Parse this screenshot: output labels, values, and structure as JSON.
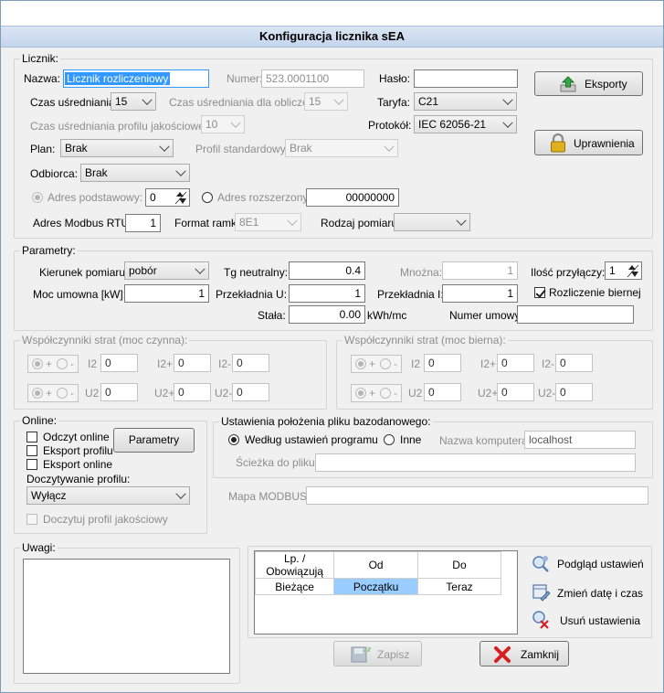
{
  "window": {
    "title": "Konfiguracja licznika sEA"
  },
  "licznik": {
    "group_title": "Licznik:",
    "nazwa_label": "Nazwa:",
    "nazwa_value": "Licznik rozliczeniowy",
    "numer_label": "Numer:",
    "numer_value": "523.0001100",
    "haslo_label": "Hasło:",
    "haslo_value": "",
    "czas_usr_label": "Czas uśredniania:",
    "czas_usr_value": "15",
    "czas_obl_label": "Czas uśredniania dla obliczeń:",
    "czas_obl_value": "15",
    "taryfa_label": "Taryfa:",
    "taryfa_value": "C21",
    "czas_prof_label": "Czas uśredniania profilu jakościowego:",
    "czas_prof_value": "10",
    "protokol_label": "Protokół:",
    "protokol_value": "IEC 62056-21",
    "plan_label": "Plan:",
    "plan_value": "Brak",
    "profil_label": "Profil standardowy:",
    "profil_value": "Brak",
    "odbiorca_label": "Odbiorca:",
    "odbiorca_value": "Brak",
    "adres_podst_label": "Adres podstawowy:",
    "adres_podst_value": "0",
    "adres_rozsz_label": "Adres rozszerzony:",
    "adres_rozsz_value": "00000000",
    "modbus_label": "Adres Modbus RTU:",
    "modbus_value": "1",
    "format_label": "Format ramki:",
    "format_value": "8E1",
    "rodzaj_label": "Rodzaj pomiaru:",
    "rodzaj_value": "",
    "eksporty_label": "Eksporty",
    "uprawnienia_label": "Uprawnienia"
  },
  "parametry": {
    "group_title": "Parametry:",
    "kierunek_label": "Kierunek pomiaru:",
    "kierunek_value": "pobór",
    "tg_label": "Tg neutralny:",
    "tg_value": "0.4",
    "mnozna_label": "Mnożna:",
    "mnozna_value": "1",
    "ilosc_label": "Ilość przyłączy:",
    "ilosc_value": "1",
    "moc_label": "Moc umowna [kW]:",
    "moc_value": "1",
    "przek_u_label": "Przekładnia U:",
    "przek_u_value": "1",
    "przek_i_label": "Przekładnia I:",
    "przek_i_value": "1",
    "rozliczenie_label": "Rozliczenie biernej",
    "stala_label": "Stała:",
    "stala_value": "0.00",
    "stala_unit": "kWh/mc",
    "numer_umowy_label": "Numer umowy:",
    "numer_umowy_value": ""
  },
  "wsp_czynna": {
    "group_title": "Współczynniki strat (moc czynna):",
    "plus": "+",
    "minus": "-",
    "i2": "I2",
    "i2p": "I2+",
    "i2m": "I2-",
    "u2": "U2",
    "u2p": "U2+",
    "u2m": "U2-",
    "i2_val": "0",
    "i2p_val": "0",
    "i2m_val": "0",
    "u2_val": "0",
    "u2p_val": "0",
    "u2m_val": "0"
  },
  "wsp_bierna": {
    "group_title": "Współczynniki strat (moc bierna):",
    "plus": "+",
    "minus": "-",
    "i2": "I2",
    "i2p": "I2+",
    "i2m": "I2-",
    "u2": "U2",
    "u2p": "U2+",
    "u2m": "U2-",
    "i2_val": "0",
    "i2p_val": "0",
    "i2m_val": "0",
    "u2_val": "0",
    "u2p_val": "0",
    "u2m_val": "0"
  },
  "online": {
    "group_title": "Online:",
    "odczyt_label": "Odczyt online",
    "eksport_profilu_label": "Eksport profilu",
    "eksport_online_label": "Eksport online",
    "parametry_button": "Parametry",
    "doczyt_label": "Doczytywanie profilu:",
    "doczyt_value": "Wyłącz",
    "doczyt_jak_label": "Doczytuj profil jakościowy"
  },
  "baza": {
    "group_title": "Ustawienia położenia pliku bazodanowego:",
    "wedlug_label": "Według ustawień programu",
    "inne_label": "Inne",
    "komputer_label": "Nazwa komputera:",
    "komputer_value": "localhost",
    "sciezka_label": "Ścieżka do pliku:",
    "sciezka_value": "",
    "mapa_label": "Mapa MODBUS:",
    "mapa_value": ""
  },
  "uwagi": {
    "group_title": "Uwagi:",
    "value": ""
  },
  "ustawienia_table": {
    "headers": [
      "Lp. / Obowiązują",
      "Od",
      "Do"
    ],
    "rows": [
      [
        "Bieżące",
        "Początku",
        "Teraz"
      ]
    ]
  },
  "actions": {
    "podglad_label": "Podgląd ustawień",
    "zmien_label": "Zmień datę i czas",
    "usun_label": "Usuń ustawienia",
    "zapisz_label": "Zapisz",
    "zamknij_label": "Zamknij"
  },
  "colors": {
    "title_bg": "#c4d5ec",
    "selection": "#3399ff",
    "close_red": "#d42020",
    "arrow_green": "#3aa64a",
    "lock_gold": "#e0b020"
  }
}
